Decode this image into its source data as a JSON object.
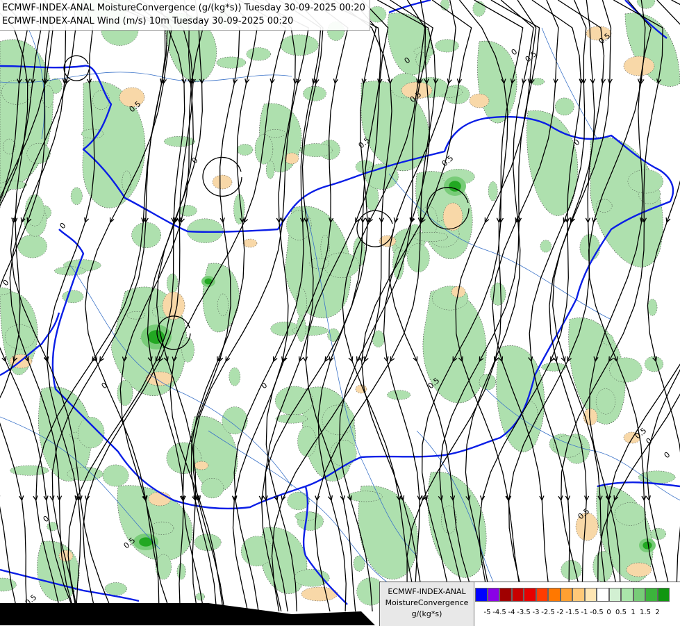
{
  "titles": {
    "line1": "ECMWF-INDEX-ANAL MoistureConvergence (g/(kg*s)) Tuesday 30-09-2025 00:20",
    "line2": "ECMWF-INDEX-ANAL Wind (m/s) 10m Tuesday 30-09-2025 00:20"
  },
  "legend": {
    "line1": "ECMWF-INDEX-ANAL",
    "line2": "MoistureConvergence",
    "line3": "g/(kg*s)",
    "colors": [
      "#0000ff",
      "#8a00e6",
      "#a00000",
      "#c80000",
      "#e60000",
      "#ff3c00",
      "#ff7800",
      "#ffa032",
      "#ffc878",
      "#ffe6b4",
      "#ffffff",
      "#d2f0d2",
      "#aae6aa",
      "#78cc78",
      "#3cb43c",
      "#109610"
    ],
    "labels": [
      "-5",
      "-4.5",
      "-4",
      "-3.5",
      "-3",
      "-2.5",
      "-2",
      "-1.5",
      "-1",
      "-0.5",
      "0",
      "0.5",
      "1",
      "1.5",
      "2"
    ]
  },
  "contour_labels": [
    "0",
    "0.5",
    "0",
    "0.5",
    "0",
    "0.5",
    "0",
    "0.5",
    "0",
    "0.5",
    "0",
    "0.5",
    "0.5",
    "0",
    "0.5",
    "0",
    "0",
    "0.5",
    "0",
    "0.5",
    "0",
    "0.5"
  ],
  "colors": {
    "positive": "#aee0ae",
    "strong": "#22a822",
    "negative": "#f8d8a8",
    "border": "#0a1ee6",
    "river": "#3a72c8",
    "streamline": "#000000"
  }
}
